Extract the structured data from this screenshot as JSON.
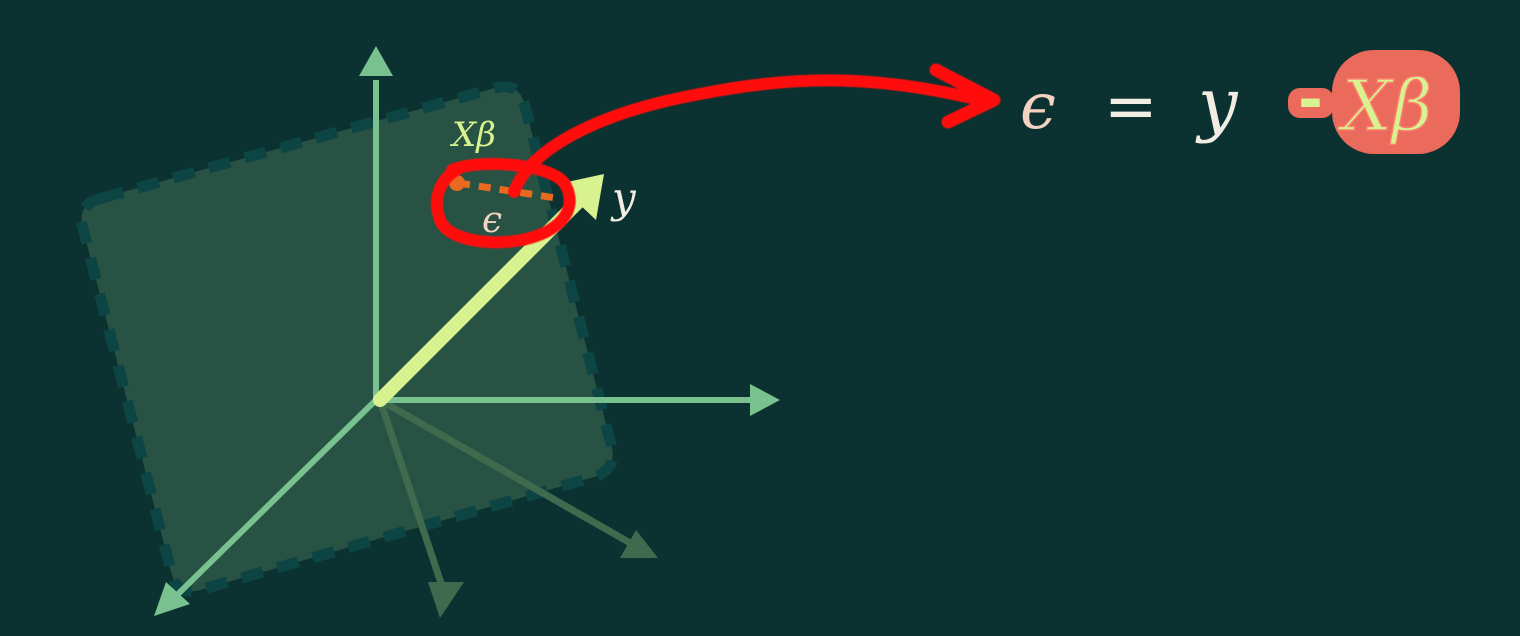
{
  "diagram": {
    "labels": {
      "xbeta": "Xβ",
      "y": "y",
      "epsilon": "ϵ"
    },
    "equation": {
      "lhs": "ϵ",
      "equals": "=",
      "y": "y",
      "minus": "-",
      "xbeta": "Xβ"
    }
  },
  "colors": {
    "background": "#0b3230",
    "plane_fill": "#2a5446",
    "plane_border": "#0d4444",
    "axis": "#79c28f",
    "axis_dim": "#3f6a4d",
    "y_vector": "#d8f28f",
    "residual": "#e86a1f",
    "annotation": "#ff1010",
    "xbeta_label": "#d8f28f",
    "epsilon_label": "#f3d2c2",
    "equation_text": "#f1ede3",
    "highlight_fill": "#ea6a5c"
  }
}
